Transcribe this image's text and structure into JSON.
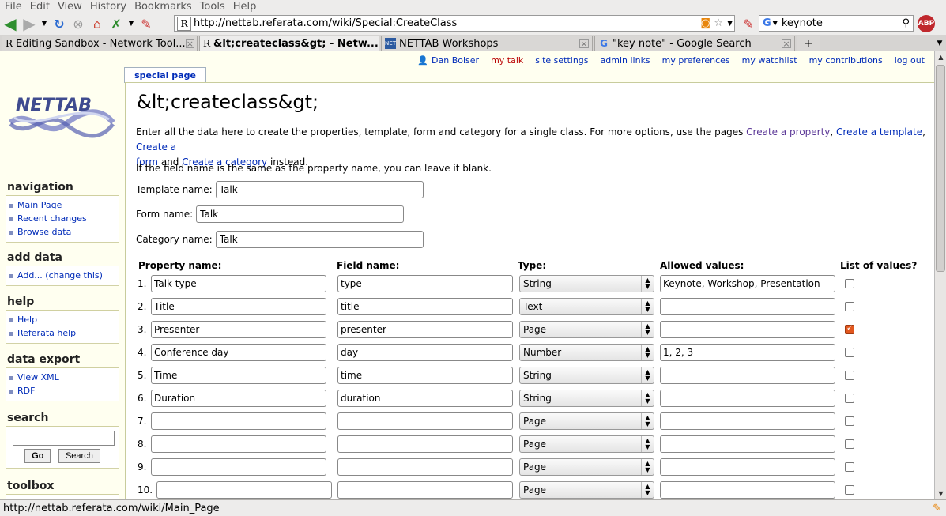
{
  "browser": {
    "menu": [
      "File",
      "Edit",
      "View",
      "History",
      "Bookmarks",
      "Tools",
      "Help"
    ],
    "url": "http://nettab.referata.com/wiki/Special:CreateClass",
    "search_value": "keynote",
    "abp_label": "ABP",
    "tabs": [
      {
        "label": "Editing Sandbox - Network Tool...",
        "icon": "R"
      },
      {
        "label": "&lt;createclass&gt; - Netw...",
        "icon": "R"
      },
      {
        "label": "NETTAB Workshops",
        "icon": "NET"
      },
      {
        "label": "\"key note\" - Google Search",
        "icon": "G"
      }
    ],
    "status_text": "http://nettab.referata.com/wiki/Main_Page"
  },
  "personal": {
    "user": "Dan Bolser",
    "links": [
      "my talk",
      "site settings",
      "admin links",
      "my preferences",
      "my watchlist",
      "my contributions",
      "log out"
    ]
  },
  "page_tab": "special page",
  "logo_text": "NETTAB",
  "sidebar": {
    "navigation": {
      "title": "navigation",
      "items": [
        "Main Page",
        "Recent changes",
        "Browse data"
      ]
    },
    "add_data": {
      "title": "add data",
      "items": [
        "Add... (change this)"
      ]
    },
    "help": {
      "title": "help",
      "items": [
        "Help",
        "Referata help"
      ]
    },
    "data_export": {
      "title": "data export",
      "items": [
        "View XML",
        "RDF"
      ]
    },
    "search": {
      "title": "search",
      "go": "Go",
      "search": "Search"
    },
    "toolbox": {
      "title": "toolbox"
    }
  },
  "main": {
    "title": "&lt;createclass&gt;",
    "intro_1": "Enter all the data here to create the properties, template, form and category for a single class. For more options, use the pages ",
    "link_property": "Create a property",
    "link_template": "Create a template",
    "link_form_1": "Create a",
    "link_form_2": "form",
    "and": "and",
    "link_category": "Create a category",
    "instead": "instead.",
    "blank_note": "If the field name is the same as the property name, you can leave it blank.",
    "template_label": "Template name:",
    "template_value": "Talk",
    "form_label": "Form name:",
    "form_value": "Talk",
    "category_label": "Category name:",
    "category_value": "Talk",
    "headers": {
      "property": "Property name:",
      "field": "Field name:",
      "type": "Type:",
      "allowed": "Allowed values:",
      "list": "List of values?"
    },
    "rows": [
      {
        "num": "1.",
        "property": "Talk type",
        "field": "type",
        "type": "String",
        "allowed": "Keynote, Workshop, Presentation",
        "list": false
      },
      {
        "num": "2.",
        "property": "Title",
        "field": "title",
        "type": "Text",
        "allowed": "",
        "list": false
      },
      {
        "num": "3.",
        "property": "Presenter",
        "field": "presenter",
        "type": "Page",
        "allowed": "",
        "list": true
      },
      {
        "num": "4.",
        "property": "Conference day",
        "field": "day",
        "type": "Number",
        "allowed": "1, 2, 3",
        "list": false
      },
      {
        "num": "5.",
        "property": "Time",
        "field": "time",
        "type": "String",
        "allowed": "",
        "list": false
      },
      {
        "num": "6.",
        "property": "Duration",
        "field": "duration",
        "type": "String",
        "allowed": "",
        "list": false
      },
      {
        "num": "7.",
        "property": "",
        "field": "",
        "type": "Page",
        "allowed": "",
        "list": false
      },
      {
        "num": "8.",
        "property": "",
        "field": "",
        "type": "Page",
        "allowed": "",
        "list": false
      },
      {
        "num": "9.",
        "property": "",
        "field": "",
        "type": "Page",
        "allowed": "",
        "list": false
      },
      {
        "num": "10.",
        "property": "",
        "field": "",
        "type": "Page",
        "allowed": "",
        "list": false
      }
    ]
  }
}
